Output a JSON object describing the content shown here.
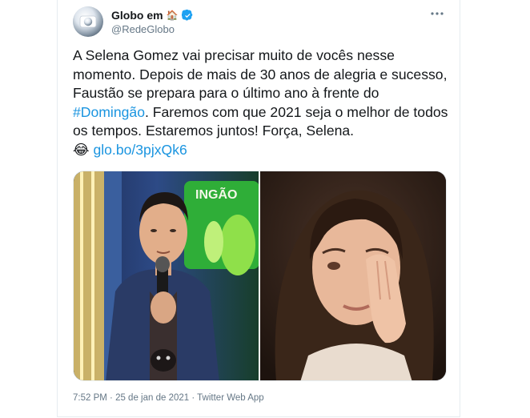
{
  "tweet": {
    "author": {
      "name": "Globo em",
      "house_emoji": "🏠",
      "handle": "@RedeGlobo",
      "verified": true
    },
    "text": {
      "part1": "A Selena Gomez vai precisar muito de vocês nesse momento. Depois de mais de 30 anos de alegria e sucesso, Faustão se prepara para o último ano à frente do ",
      "hashtag": "#Domingão",
      "part2": ". Faremos com que 2021 seja o melhor de todos os tempos. Estaremos juntos! Força, Selena.\n",
      "emoji": "😂",
      "link": "glo.bo/3pjxQk6"
    },
    "media": {
      "left_sign_text": "INGÃO",
      "items": [
        "man-holding-microphone",
        "woman-crying"
      ]
    },
    "footer": {
      "time": "7:52 PM",
      "sep1": " · ",
      "date": "25 de jan de 2021",
      "sep2": " · ",
      "source": "Twitter Web App"
    }
  },
  "colors": {
    "link": "#1b95e0",
    "text": "#14171a",
    "muted": "#657786",
    "verified": "#1da1f2"
  },
  "icons": [
    "globo-logo-icon",
    "house-emoji-icon",
    "verified-badge-icon",
    "more-options-icon"
  ]
}
